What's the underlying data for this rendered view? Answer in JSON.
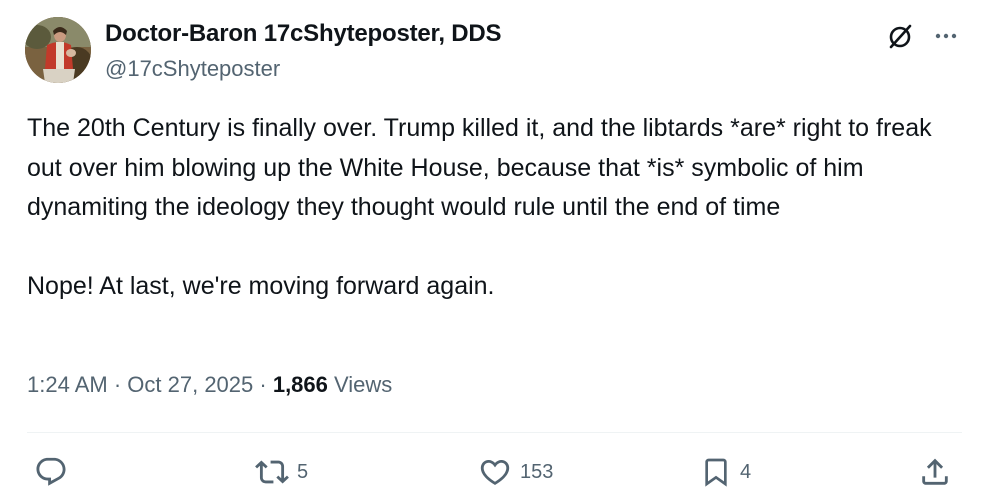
{
  "author": {
    "display_name": "Doctor-Baron 17cShyteposter, DDS",
    "handle": "@17cShyteposter"
  },
  "tweet": {
    "paragraph_1": "The 20th Century is finally over. Trump killed it, and the libtards *are* right to freak out over him blowing up the White House, because that *is* symbolic of him dynamiting the ideology they thought would rule until the end of time",
    "paragraph_2": "Nope! At last, we're moving forward again."
  },
  "meta": {
    "time": "1:24 AM",
    "separator": " · ",
    "date": "Oct 27, 2025",
    "views_count": "1,866",
    "views_label": "Views"
  },
  "actions": {
    "reply_count": "",
    "retweet_count": "5",
    "like_count": "153",
    "bookmark_count": "4"
  },
  "icons": {
    "header": [
      "grok-icon",
      "more-icon"
    ],
    "actions": [
      "reply-icon",
      "retweet-icon",
      "like-icon",
      "bookmark-icon",
      "share-icon"
    ]
  },
  "colors": {
    "text_primary": "#0f1419",
    "text_secondary": "#536471",
    "divider": "#eff3f4"
  }
}
